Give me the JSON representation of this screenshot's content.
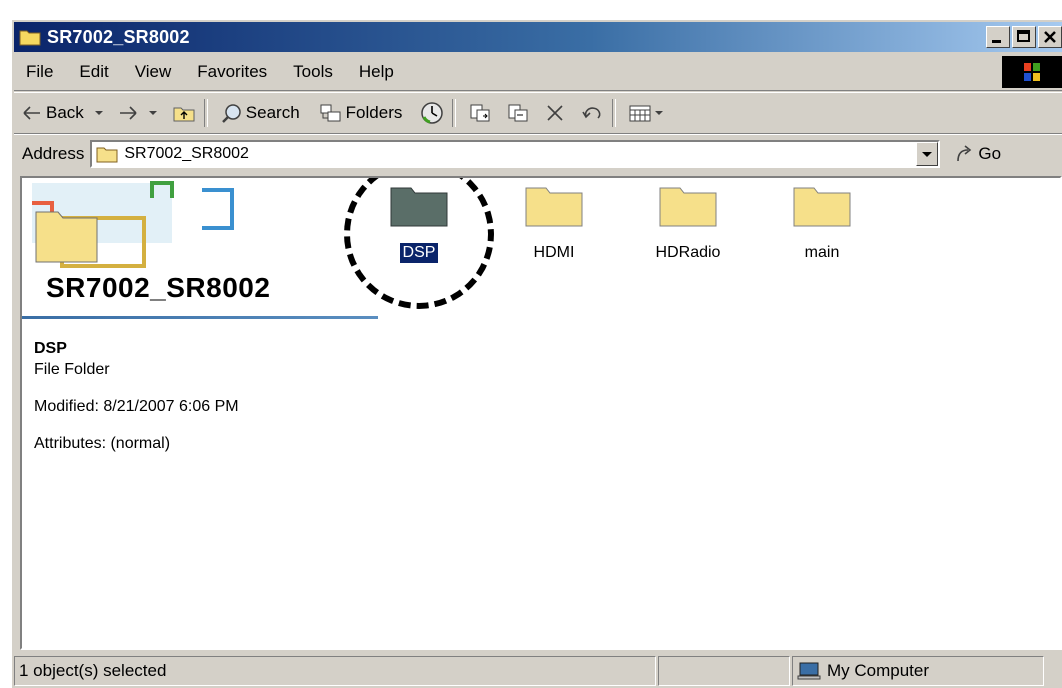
{
  "window": {
    "title": "SR7002_SR8002"
  },
  "menu": [
    "File",
    "Edit",
    "View",
    "Favorites",
    "Tools",
    "Help"
  ],
  "toolbar": {
    "back": "Back",
    "search": "Search",
    "folders": "Folders"
  },
  "address": {
    "label": "Address",
    "value": "SR7002_SR8002",
    "go": "Go"
  },
  "banner": {
    "title": "SR7002_SR8002"
  },
  "details": {
    "name": "DSP",
    "type": "File Folder",
    "modified": "Modified: 8/21/2007 6:06 PM",
    "attributes": "Attributes: (normal)"
  },
  "folders": [
    {
      "label": "DSP",
      "selected": true
    },
    {
      "label": "HDMI",
      "selected": false
    },
    {
      "label": "HDRadio",
      "selected": false
    },
    {
      "label": "main",
      "selected": false
    }
  ],
  "status": {
    "selection": "1 object(s) selected",
    "zone": "My Computer"
  },
  "colors": {
    "title_start": "#0a246a",
    "title_end": "#a6caf0",
    "selection": "#0a246a",
    "folder_fill": "#f6e08a",
    "selected_folder_fill": "#5a6e68"
  }
}
